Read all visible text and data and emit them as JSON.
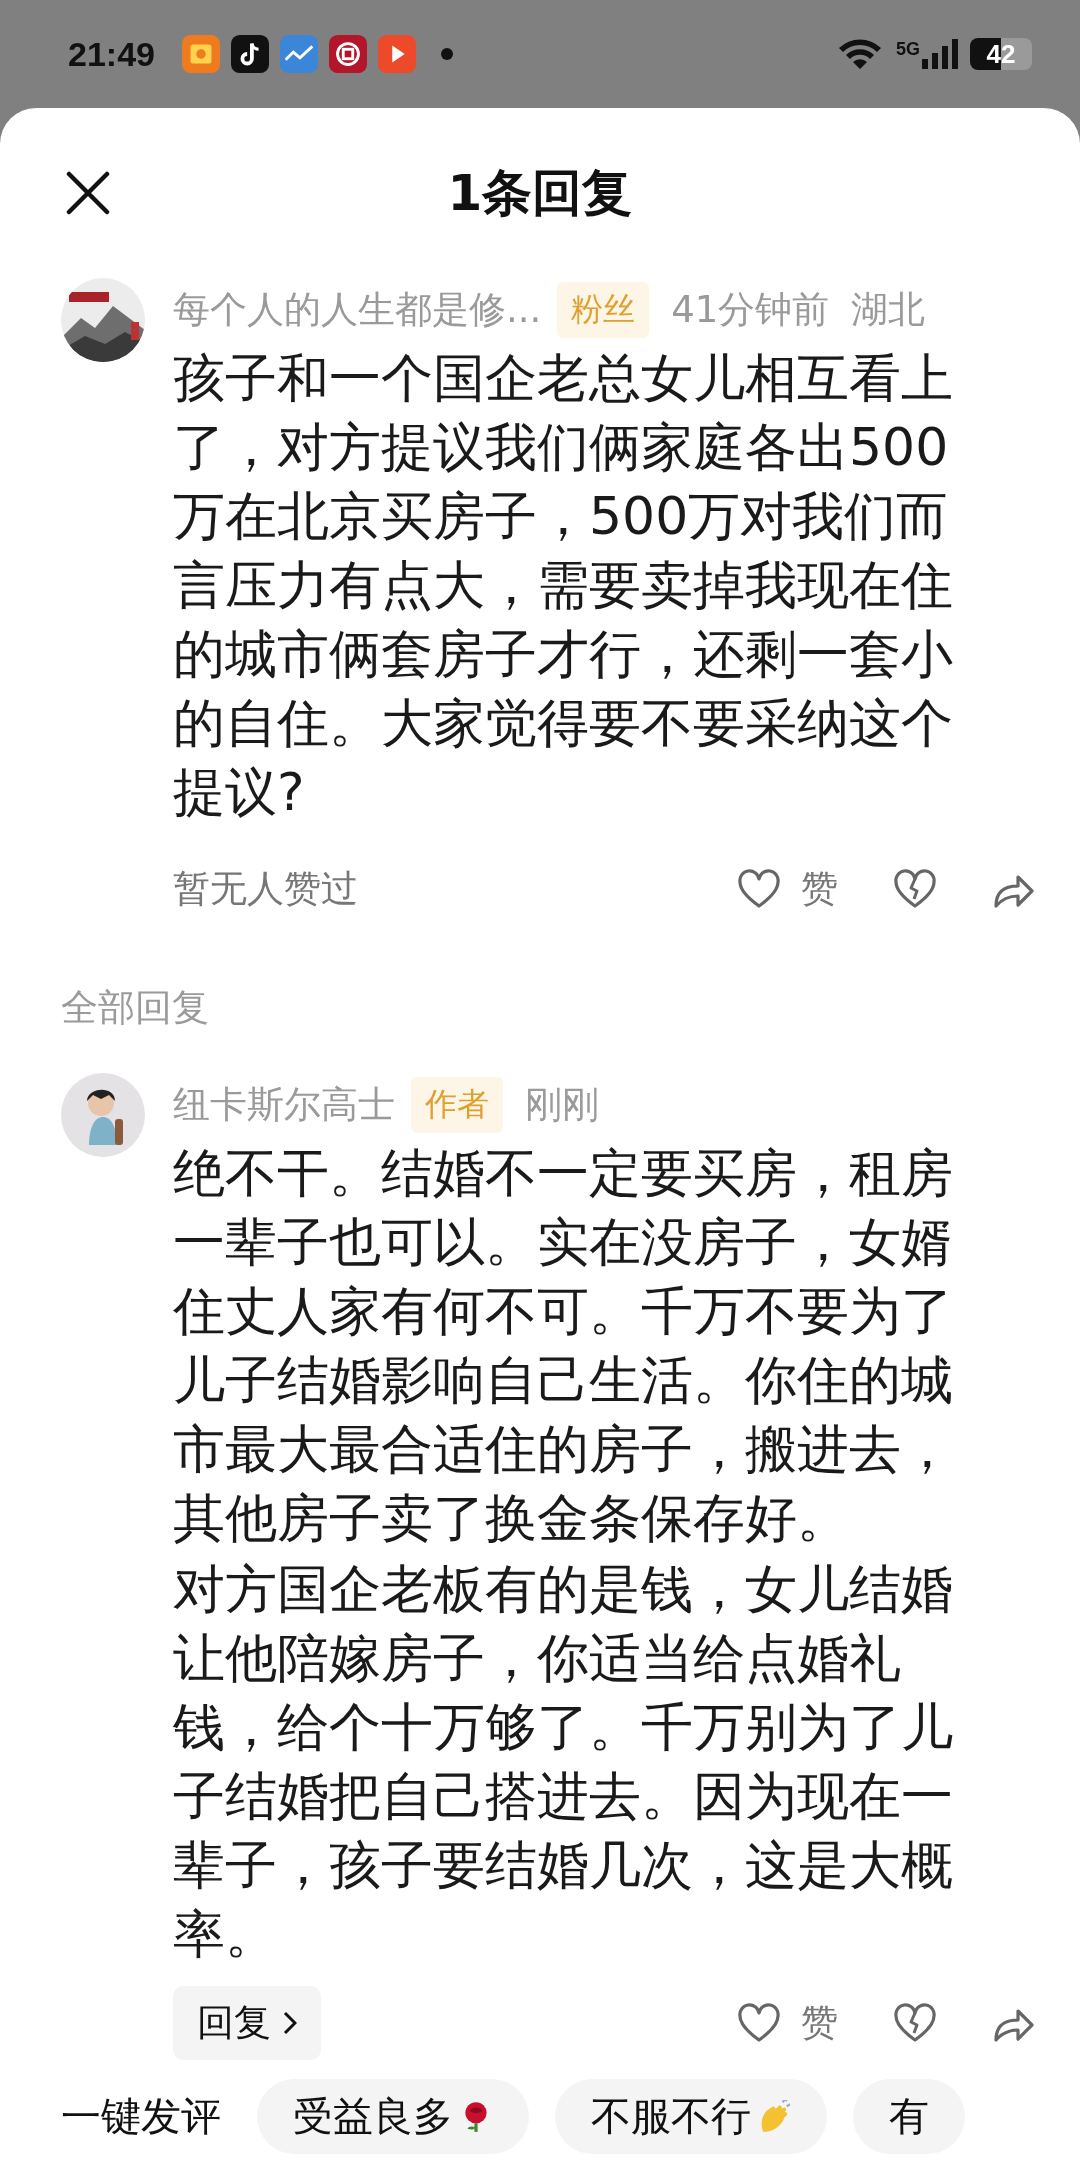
{
  "status_bar": {
    "time": "21:49",
    "network": "5G",
    "battery": "42"
  },
  "header": {
    "title": "1条回复"
  },
  "comment": {
    "author": "每个人的人生都是修...",
    "badge": "粉丝",
    "time": "41分钟前",
    "location": "湖北",
    "text": "孩子和一个国企老总女儿相互看上了，对方提议我们俩家庭各出500万在北京买房子，500万对我们而言压力有点大，需要卖掉我现在住的城市俩套房子才行，还剩一套小的自住。大家觉得要不要采纳这个提议?",
    "likes_text": "暂无人赞过",
    "like_label": "赞"
  },
  "section_title": "全部回复",
  "replies": [
    {
      "author": "纽卡斯尔高士",
      "badge": "作者",
      "time": "刚刚",
      "paragraphs": [
        "绝不干。结婚不一定要买房，租房一辈子也可以。实在没房子，女婿住丈人家有何不可。千万不要为了儿子结婚影响自己生活。你住的城市最大最合适住的房子，搬进去，其他房子卖了换金条保存好。",
        "对方国企老板有的是钱，女儿结婚让他陪嫁房子，你适当给点婚礼钱，给个十万够了。千万别为了儿子结婚把自己搭进去。因为现在一辈子，孩子要结婚几次，这是大概率。"
      ],
      "reply_button": "回复",
      "like_label": "赞"
    }
  ],
  "quick_comments": {
    "label": "一键发评",
    "chips": [
      {
        "text": "受益良多",
        "kind": "rose"
      },
      {
        "text": "不服不行",
        "kind": "clap"
      },
      {
        "text": "有"
      }
    ]
  }
}
